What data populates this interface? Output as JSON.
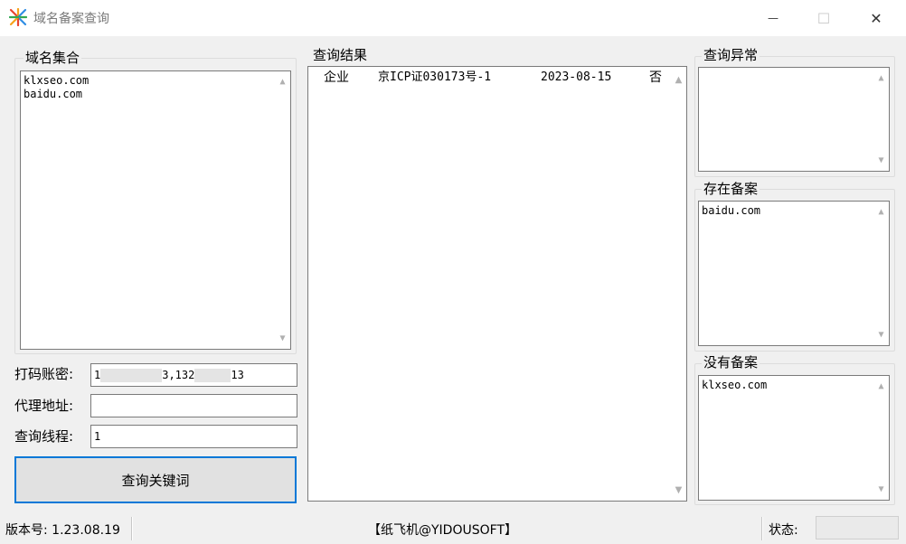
{
  "window": {
    "title": "域名备案查询",
    "minimize_glyph": "—",
    "maximize_glyph": "☐",
    "close_glyph": "✕"
  },
  "domain_group": {
    "label": "域名集合",
    "lines": [
      "klxseo.com",
      "baidu.com"
    ]
  },
  "form": {
    "account_label": "打码账密:",
    "account_value_start": "1",
    "account_value_mid": "3,132",
    "account_value_end": "13",
    "proxy_label": "代理地址:",
    "proxy_value": "",
    "threads_label": "查询线程:",
    "threads_value": "1",
    "query_button_label": "查询关键词"
  },
  "results": {
    "label": "查询结果",
    "rows": [
      {
        "type": "企业",
        "icp": "京ICP证030173号-1",
        "date": "2023-08-15",
        "flag": "否"
      }
    ]
  },
  "error_group": {
    "label": "查询异常",
    "lines": []
  },
  "exists_group": {
    "label": "存在备案",
    "lines": [
      "baidu.com"
    ]
  },
  "none_group": {
    "label": "没有备案",
    "lines": [
      "klxseo.com"
    ]
  },
  "statusbar": {
    "version": "版本号: 1.23.08.19",
    "brand": "【纸飞机@YIDOUSOFT】",
    "status_label": "状态:"
  },
  "icons": {
    "scroll_up": "▲",
    "scroll_down": "▼"
  }
}
